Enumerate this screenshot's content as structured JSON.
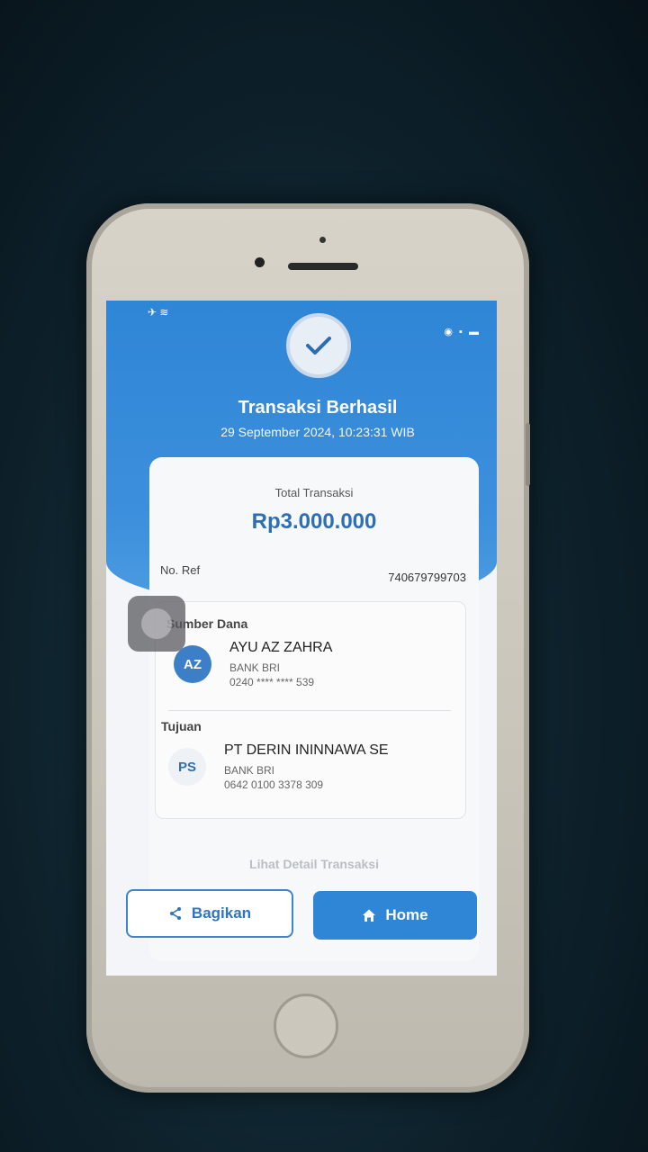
{
  "status_bar": {
    "left": "✈ ≋",
    "right": "◉ ▪ ▬"
  },
  "header": {
    "title": "Transaksi Berhasil",
    "datetime": "29 September 2024, 10:23:31 WIB"
  },
  "summary": {
    "total_label": "Total Transaksi",
    "total_amount": "Rp3.000.000",
    "ref_label": "No. Ref",
    "ref_value": "740679799703"
  },
  "source": {
    "section_label": "Sumber Dana",
    "initials": "AZ",
    "name": "AYU AZ ZAHRA",
    "bank": "BANK BRI",
    "account": "0240 **** **** 539"
  },
  "destination": {
    "section_label": "Tujuan",
    "initials": "PS",
    "name": "PT DERIN ININNAWA SE",
    "bank": "BANK BRI",
    "account": "0642 0100 3378 309"
  },
  "detail_link": "Lihat Detail Transaksi",
  "actions": {
    "share_label": "Bagikan",
    "home_label": "Home"
  },
  "colors": {
    "primary": "#2f86d6",
    "amount": "#2d6fb3",
    "avatar_source": "#3d7fc6"
  }
}
